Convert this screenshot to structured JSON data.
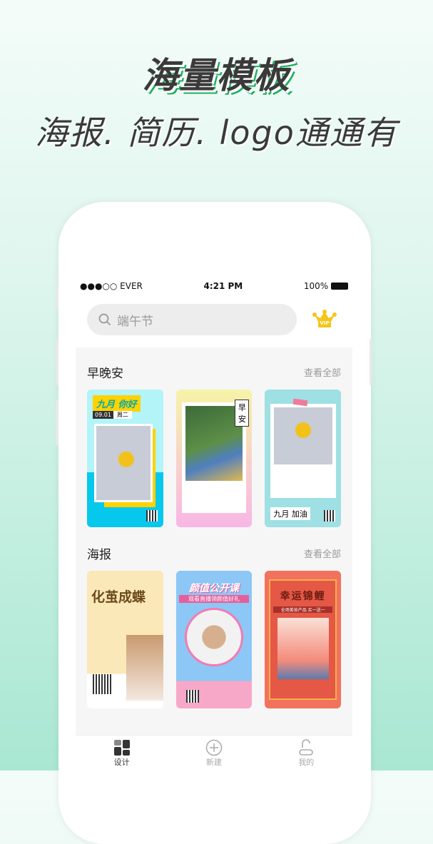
{
  "headline": {
    "title": "海量模板",
    "subtitle": "海报. 简历. logo通通有"
  },
  "status_bar": {
    "carrier": "●●●○○ EVER",
    "time": "4:21 PM",
    "battery": "100%"
  },
  "search": {
    "placeholder": "端午节",
    "icon": "search-icon"
  },
  "vip": {
    "label": "VIP",
    "color": "#f5c518"
  },
  "sections": [
    {
      "title": "早晚安",
      "more": "查看全部",
      "cards": [
        {
          "text": "九月 你好",
          "date": "09.01",
          "day": "周二"
        },
        {
          "text": "早安"
        },
        {
          "text": "九月 加油"
        }
      ]
    },
    {
      "title": "海报",
      "more": "查看全部",
      "cards": [
        {
          "text": "化茧成蝶"
        },
        {
          "text": "颜值公开课",
          "sub": "观看直播领颜值好礼"
        },
        {
          "text": "幸运锦鲤",
          "sub": "全场美妆产品 买一送一"
        }
      ]
    }
  ],
  "tabs": [
    {
      "label": "设计",
      "active": true
    },
    {
      "label": "新建"
    },
    {
      "label": "我的"
    }
  ]
}
